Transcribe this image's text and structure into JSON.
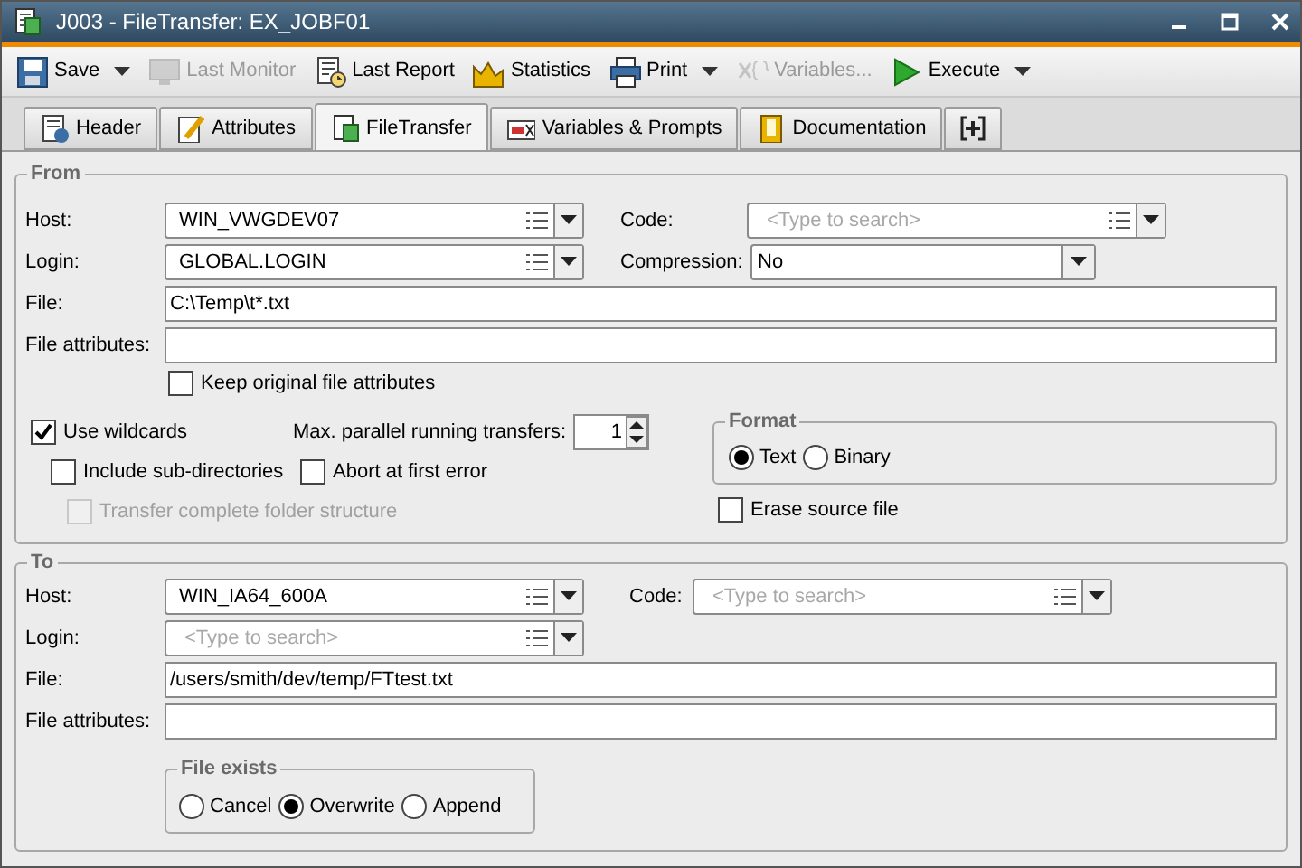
{
  "window": {
    "title": "J003 - FileTransfer: EX_JOBF01"
  },
  "toolbar": [
    {
      "label": "Save",
      "disabled": false,
      "dropdown": true
    },
    {
      "label": "Last Monitor",
      "disabled": true,
      "dropdown": false
    },
    {
      "label": "Last Report",
      "disabled": false,
      "dropdown": false
    },
    {
      "label": "Statistics",
      "disabled": false,
      "dropdown": false
    },
    {
      "label": "Print",
      "disabled": false,
      "dropdown": true
    },
    {
      "label": "Variables...",
      "disabled": true,
      "dropdown": false
    },
    {
      "label": "Execute",
      "disabled": false,
      "dropdown": true
    }
  ],
  "tabs": [
    {
      "kind": "page",
      "label": "Header",
      "selected": false
    },
    {
      "kind": "page",
      "label": "Attributes",
      "selected": false
    },
    {
      "kind": "page",
      "label": "FileTransfer",
      "selected": true
    },
    {
      "kind": "page",
      "label": "Variables & Prompts",
      "selected": false
    },
    {
      "kind": "page",
      "label": "Documentation",
      "selected": false
    },
    {
      "kind": "add",
      "selected": false
    }
  ],
  "from": {
    "legend": "From",
    "host": {
      "label": "Host:",
      "value": "WIN_VWGDEV07"
    },
    "code": {
      "label": "Code:",
      "placeholder": "<Type to search>"
    },
    "login": {
      "label": "Login:",
      "value": "GLOBAL.LOGIN"
    },
    "compression": {
      "label": "Compression:",
      "value": "No"
    },
    "file": {
      "label": "File:",
      "value": "C:\\Temp\\t*.txt"
    },
    "file_attributes": {
      "label": "File attributes:"
    },
    "keep_attributes": {
      "label": "Keep original file attributes",
      "checked": false,
      "disabled": false
    },
    "use_wildcards": {
      "label": "Use wildcards",
      "checked": true,
      "disabled": false
    },
    "max_parallel": {
      "label": "Max. parallel running transfers:",
      "value": "1"
    },
    "include_subdirectories": {
      "label": "Include sub-directories",
      "checked": false,
      "disabled": false
    },
    "abort_at_first_error": {
      "label": "Abort at first error",
      "checked": false,
      "disabled": false
    },
    "transfer_folder_structure": {
      "label": "Transfer complete folder structure",
      "checked": false,
      "disabled": true
    },
    "format": {
      "legend": "Format",
      "options": [
        {
          "label": "Text",
          "selected": true
        },
        {
          "label": "Binary",
          "selected": false
        }
      ]
    },
    "erase_source": {
      "label": "Erase source file",
      "checked": false,
      "disabled": false
    }
  },
  "to": {
    "legend": "To",
    "host": {
      "label": "Host:",
      "value": "WIN_IA64_600A"
    },
    "code": {
      "label": "Code:",
      "placeholder": "<Type to search>"
    },
    "login": {
      "label": "Login:",
      "placeholder": "<Type to search>"
    },
    "file": {
      "label": "File:",
      "value": "/users/smith/dev/temp/FTtest.txt"
    },
    "file_attributes": {
      "label": "File attributes:"
    },
    "file_exists": {
      "legend": "File exists",
      "options": [
        {
          "label": "Cancel",
          "selected": false
        },
        {
          "label": "Overwrite",
          "selected": true
        },
        {
          "label": "Append",
          "selected": false
        }
      ]
    }
  }
}
